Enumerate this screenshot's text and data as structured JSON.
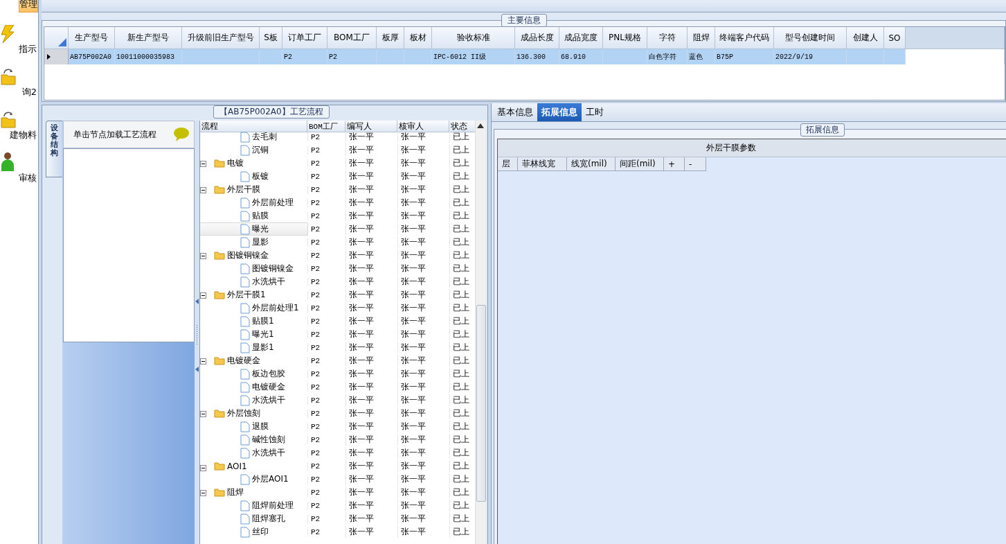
{
  "sidebar": {
    "items": [
      {
        "label": "管理",
        "selected": true
      },
      {
        "label": "指示",
        "selected": false,
        "kind": "bolt"
      },
      {
        "label": "询2",
        "selected": false,
        "kind": "folder"
      },
      {
        "label": "建物料",
        "selected": false,
        "kind": "folder"
      },
      {
        "label": "审核",
        "selected": false,
        "kind": "person"
      }
    ]
  },
  "main_info": {
    "title": "主要信息",
    "columns": [
      "生产型号",
      "新生产型号",
      "升级前旧生产型号",
      "S板",
      "订单工厂",
      "BOM工厂",
      "板厚",
      "板材",
      "验收标准",
      "成品长度",
      "成品宽度",
      "PNL规格",
      "字符",
      "阻焊",
      "终端客户代码",
      "型号创建时间",
      "创建人",
      "SO"
    ],
    "rows": [
      {
        "selected": true,
        "cells": [
          "AB75P002A0",
          "10011000035983",
          "",
          "",
          "P2",
          "P2",
          "",
          "",
          "IPC-6012 II级",
          "136.300",
          "68.910",
          "",
          "白色字符",
          "蓝色",
          "B75P",
          "2022/9/19",
          "",
          ""
        ]
      }
    ]
  },
  "flow": {
    "title": "【AB75P002A0】工艺流程",
    "side_tab": "设备结构",
    "hint": "单击节点加载工艺流程",
    "columns": [
      "流程",
      "BOM工厂",
      "编写人",
      "核审人",
      "状态"
    ],
    "tree": [
      {
        "children": [
          {
            "label": "去毛刺",
            "bom": "P2",
            "writer": "张一平",
            "reviewer": "张一平",
            "status": "已上",
            "selected": false
          },
          {
            "label": "沉铜",
            "bom": "P2",
            "writer": "张一平",
            "reviewer": "张一平",
            "status": "已上",
            "selected": false
          }
        ]
      },
      {
        "label": "电镀",
        "bom": "P2",
        "writer": "张一平",
        "reviewer": "张一平",
        "status": "已上",
        "selected": false,
        "children": [
          {
            "label": "板镀",
            "bom": "P2",
            "writer": "张一平",
            "reviewer": "张一平",
            "status": "已上",
            "selected": false
          }
        ]
      },
      {
        "label": "外层干膜",
        "bom": "P2",
        "writer": "张一平",
        "reviewer": "张一平",
        "status": "已上",
        "selected": false,
        "children": [
          {
            "label": "外层前处理",
            "bom": "P2",
            "writer": "张一平",
            "reviewer": "张一平",
            "status": "已上",
            "selected": false
          },
          {
            "label": "贴膜",
            "bom": "P2",
            "writer": "张一平",
            "reviewer": "张一平",
            "status": "已上",
            "selected": false
          },
          {
            "label": "曝光",
            "bom": "P2",
            "writer": "张一平",
            "reviewer": "张一平",
            "status": "已上",
            "selected": true
          },
          {
            "label": "显影",
            "bom": "P2",
            "writer": "张一平",
            "reviewer": "张一平",
            "status": "已上",
            "selected": false
          }
        ]
      },
      {
        "label": "图镀铜镍金",
        "bom": "P2",
        "writer": "张一平",
        "reviewer": "张一平",
        "status": "已上",
        "selected": false,
        "children": [
          {
            "label": "图镀铜镍金",
            "bom": "P2",
            "writer": "张一平",
            "reviewer": "张一平",
            "status": "已上",
            "selected": false
          },
          {
            "label": "水洗烘干",
            "bom": "P2",
            "writer": "张一平",
            "reviewer": "张一平",
            "status": "已上",
            "selected": false
          }
        ]
      },
      {
        "label": "外层干膜1",
        "bom": "P2",
        "writer": "张一平",
        "reviewer": "张一平",
        "status": "已上",
        "selected": false,
        "children": [
          {
            "label": "外层前处理1",
            "bom": "P2",
            "writer": "张一平",
            "reviewer": "张一平",
            "status": "已上",
            "selected": false
          },
          {
            "label": "贴膜1",
            "bom": "P2",
            "writer": "张一平",
            "reviewer": "张一平",
            "status": "已上",
            "selected": false
          },
          {
            "label": "曝光1",
            "bom": "P2",
            "writer": "张一平",
            "reviewer": "张一平",
            "status": "已上",
            "selected": false
          },
          {
            "label": "显影1",
            "bom": "P2",
            "writer": "张一平",
            "reviewer": "张一平",
            "status": "已上",
            "selected": false
          }
        ]
      },
      {
        "label": "电镀硬金",
        "bom": "P2",
        "writer": "张一平",
        "reviewer": "张一平",
        "status": "已上",
        "selected": false,
        "children": [
          {
            "label": "板边包胶",
            "bom": "P2",
            "writer": "张一平",
            "reviewer": "张一平",
            "status": "已上",
            "selected": false
          },
          {
            "label": "电镀硬金",
            "bom": "P2",
            "writer": "张一平",
            "reviewer": "张一平",
            "status": "已上",
            "selected": false
          },
          {
            "label": "水洗烘干",
            "bom": "P2",
            "writer": "张一平",
            "reviewer": "张一平",
            "status": "已上",
            "selected": false
          }
        ]
      },
      {
        "label": "外层蚀刻",
        "bom": "P2",
        "writer": "张一平",
        "reviewer": "张一平",
        "status": "已上",
        "selected": false,
        "children": [
          {
            "label": "退膜",
            "bom": "P2",
            "writer": "张一平",
            "reviewer": "张一平",
            "status": "已上",
            "selected": false
          },
          {
            "label": "碱性蚀刻",
            "bom": "P2",
            "writer": "张一平",
            "reviewer": "张一平",
            "status": "已上",
            "selected": false
          },
          {
            "label": "水洗烘干",
            "bom": "P2",
            "writer": "张一平",
            "reviewer": "张一平",
            "status": "已上",
            "selected": false
          }
        ]
      },
      {
        "label": "AOI1",
        "bom": "P2",
        "writer": "张一平",
        "reviewer": "张一平",
        "status": "已上",
        "selected": false,
        "children": [
          {
            "label": "外层AOI1",
            "bom": "P2",
            "writer": "张一平",
            "reviewer": "张一平",
            "status": "已上",
            "selected": false
          }
        ]
      },
      {
        "label": "阻焊",
        "bom": "P2",
        "writer": "张一平",
        "reviewer": "张一平",
        "status": "已上",
        "selected": false,
        "children": [
          {
            "label": "阻焊前处理",
            "bom": "P2",
            "writer": "张一平",
            "reviewer": "张一平",
            "status": "已上",
            "selected": false
          },
          {
            "label": "阻焊塞孔",
            "bom": "P2",
            "writer": "张一平",
            "reviewer": "张一平",
            "status": "已上",
            "selected": false
          },
          {
            "label": "丝印",
            "bom": "P2",
            "writer": "张一平",
            "reviewer": "张一平",
            "status": "已上",
            "selected": false
          }
        ]
      }
    ]
  },
  "details": {
    "tabs": [
      {
        "label": "基本信息",
        "selected": false
      },
      {
        "label": "拓展信息",
        "selected": true
      },
      {
        "label": "工时",
        "selected": false
      }
    ],
    "group_title": "拓展信息",
    "table": {
      "title": "外层干膜参数",
      "columns": [
        "层",
        "菲林线宽",
        "线宽(mil)",
        "间距(mil)",
        "+",
        "-"
      ]
    }
  }
}
